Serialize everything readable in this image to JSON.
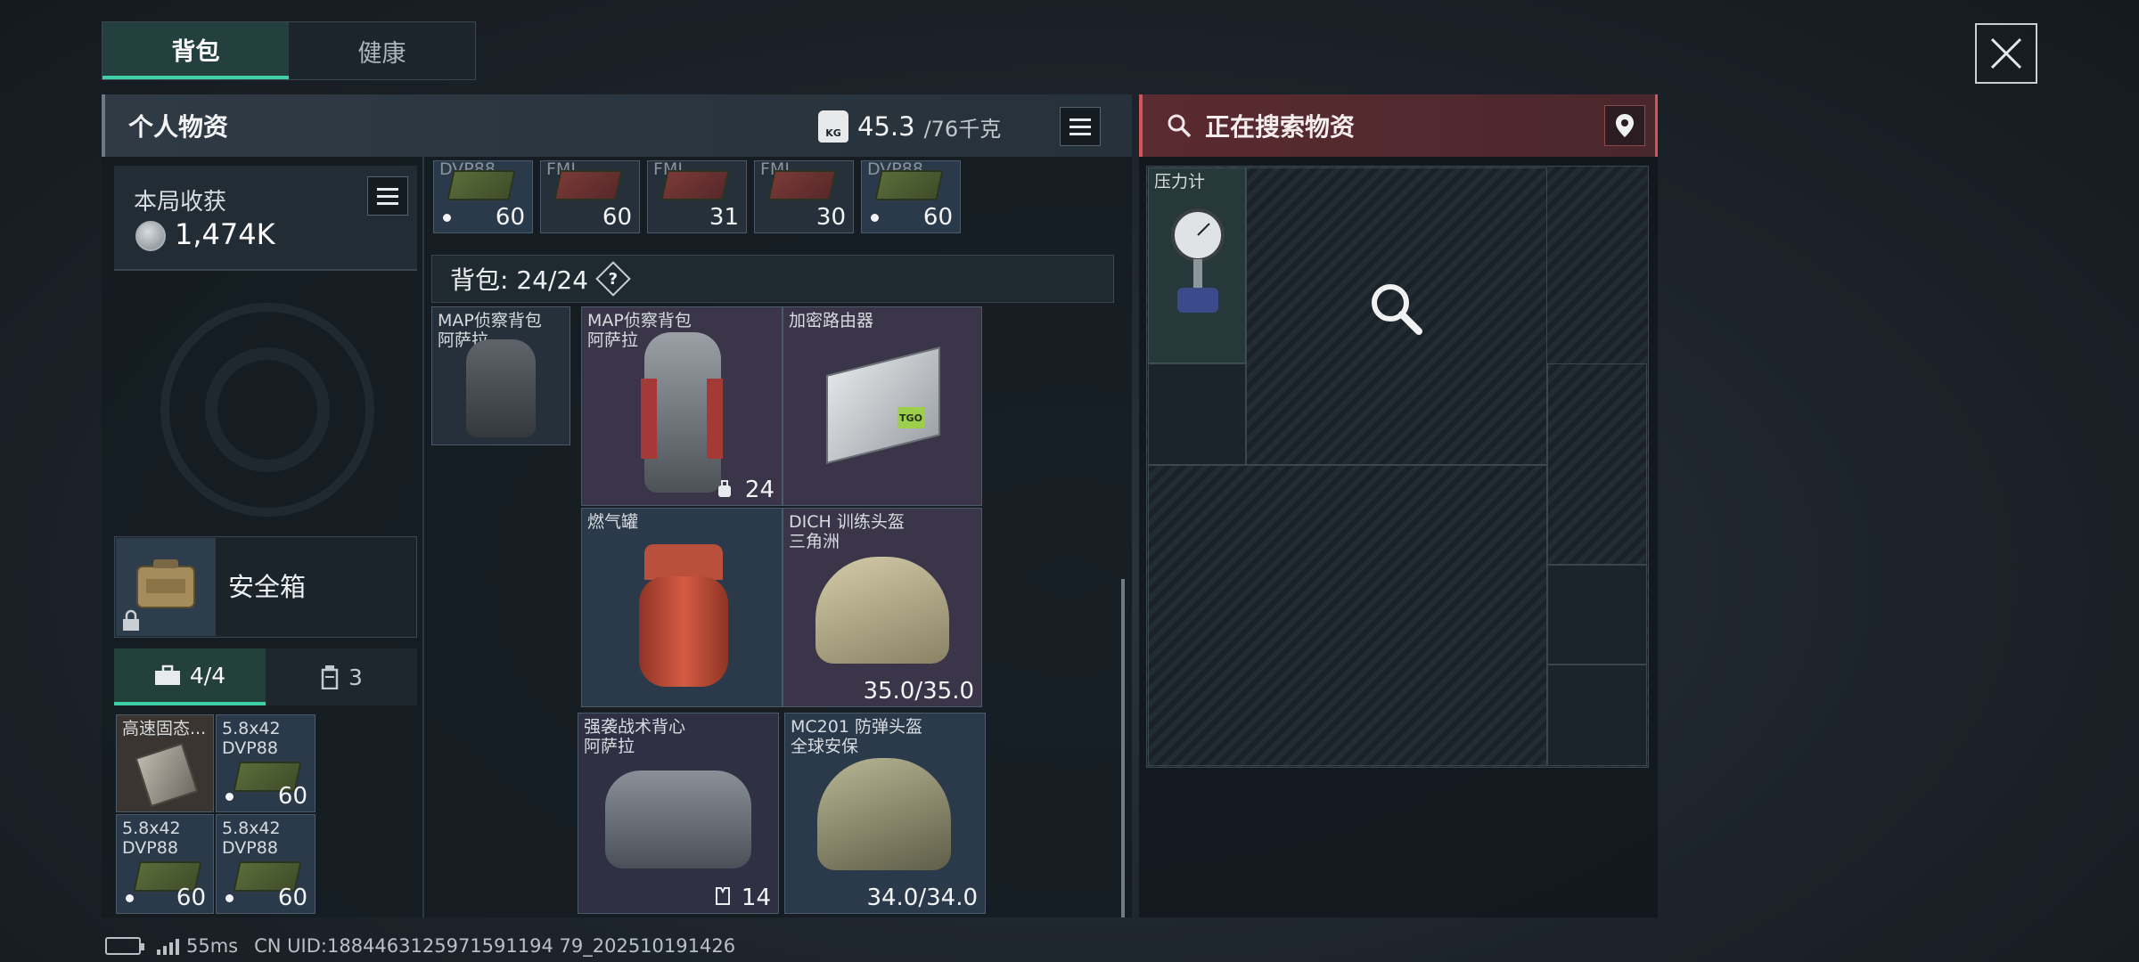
{
  "tabs": [
    {
      "label": "背包",
      "active": true
    },
    {
      "label": "健康",
      "active": false
    }
  ],
  "inventory": {
    "title": "个人物资",
    "weight_current": "45.3",
    "weight_limit": "/76千克",
    "weight_icon_text": "KG"
  },
  "haul": {
    "label": "本局收获",
    "value": "1,474K"
  },
  "safe_box": {
    "label": "安全箱"
  },
  "sub_tabs": [
    {
      "label": "4/4",
      "icon": "toolbox-icon"
    },
    {
      "label": "3",
      "icon": "canister-icon"
    }
  ],
  "pouch_items": [
    {
      "name": "高速固态...",
      "qty": ""
    },
    {
      "name": "5.8x42\nDVP88",
      "qty": "60"
    },
    {
      "name": "5.8x42\nDVP88",
      "qty": "60"
    },
    {
      "name": "5.8x42\nDVP88",
      "qty": "60"
    }
  ],
  "top_row_items": [
    {
      "name": "DVP88",
      "qty": "60"
    },
    {
      "name": "FMJ",
      "qty": "60"
    },
    {
      "name": "FMJ",
      "qty": "31"
    },
    {
      "name": "FMJ",
      "qty": "30"
    },
    {
      "name": "DVP88",
      "qty": "60"
    }
  ],
  "backpack": {
    "title": "背包: 24/24",
    "help": "?"
  },
  "bag_items": {
    "equipped_bag": "MAP侦察背包\n阿萨拉",
    "map_bag": "MAP侦察背包\n阿萨拉",
    "map_bag_capacity": "24",
    "router": "加密路由器",
    "router_tag": "TGO",
    "gas_tank": "燃气罐",
    "dich_helmet": "DICH 训练头盔\n三角洲",
    "dich_durability": "35.0/35.0",
    "vest": "强袭战术背心\n阿萨拉",
    "vest_capacity": "14",
    "mc201_helmet": "MC201 防弹头盔\n全球安保",
    "mc201_durability": "34.0/34.0"
  },
  "search": {
    "title": "正在搜索物资",
    "found_item": "压力计"
  },
  "status_bar": {
    "ping": "55ms",
    "uid": "CN UID:1884463125971591194 79_202510191426"
  },
  "colors": {
    "accent": "#3fd0a8",
    "search_red": "#d2545b",
    "text": "#e6e9ec"
  }
}
